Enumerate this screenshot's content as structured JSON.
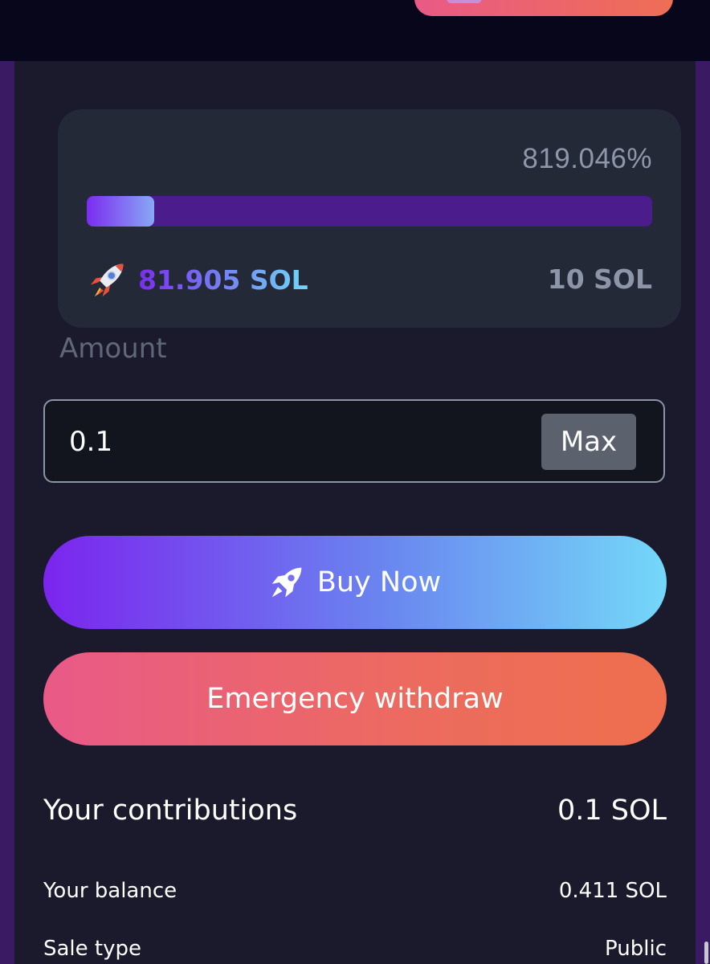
{
  "progress": {
    "percent_text": "819.046%",
    "fill_fraction": 0.12,
    "raised": "81.905 SOL",
    "target": "10 SOL"
  },
  "amount": {
    "label": "Amount",
    "value": "0.1",
    "max_label": "Max"
  },
  "actions": {
    "buy_label": "Buy Now",
    "withdraw_label": "Emergency withdraw"
  },
  "info": {
    "contributions_label": "Your contributions",
    "contributions_value": "0.1 SOL",
    "balance_label": "Your balance",
    "balance_value": "0.411 SOL",
    "sale_type_label": "Sale type",
    "sale_type_value": "Public"
  },
  "colors": {
    "brand_gradient_start": "#7b25ee",
    "brand_gradient_end": "#74d8f8",
    "danger_gradient_start": "#e95a88",
    "danger_gradient_end": "#ee6f4e",
    "progress_track": "#4a1c8c"
  },
  "icons": {
    "raised": "rocket-emoji-icon",
    "buy": "rocket-icon"
  }
}
